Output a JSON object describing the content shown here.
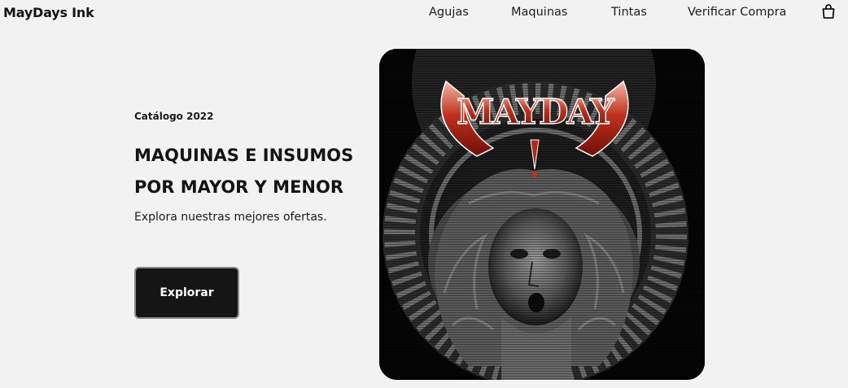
{
  "nav": {
    "brand": "MayDays Ink",
    "links": [
      "Agujas",
      "Maquinas",
      "Tintas",
      "Verificar Compra"
    ],
    "cart_icon": "shopping-bag-icon"
  },
  "hero": {
    "kicker": "Catálogo 2022",
    "headline": "MAQUINAS E INSUMOS POR MAYOR Y MENOR",
    "subtitle": "Explora nuestras mejores ofertas.",
    "cta_label": "Explorar"
  },
  "poster": {
    "logo_text": "MAYDAY",
    "colors": {
      "background": "#050505",
      "logo": "#b5261a",
      "rays": "#6e6e6e"
    }
  }
}
